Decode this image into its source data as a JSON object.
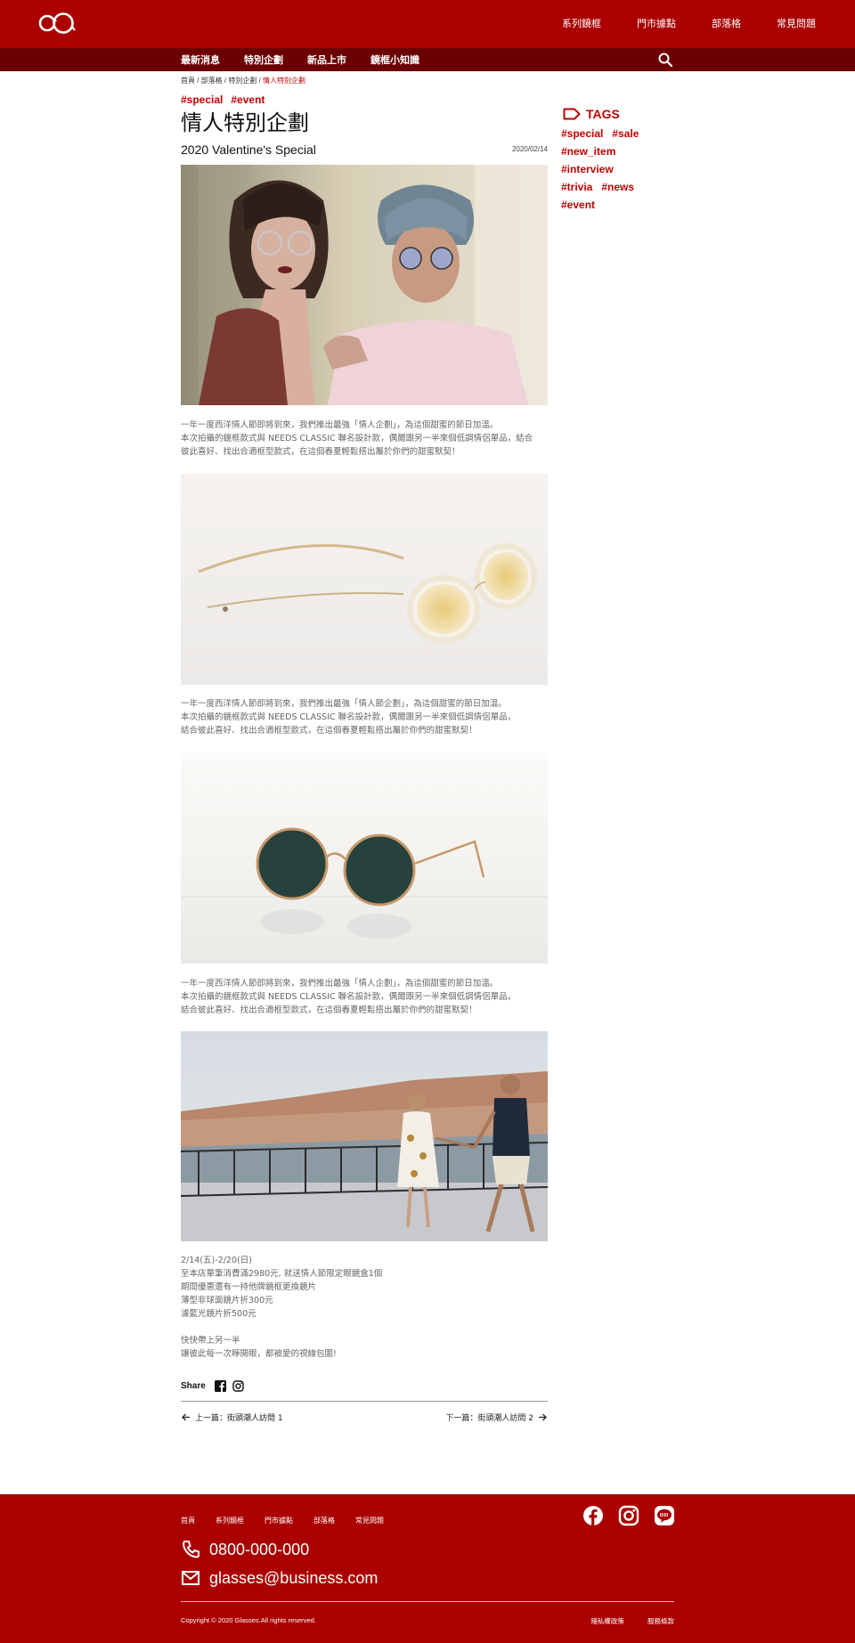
{
  "header": {
    "nav": [
      "系列鏡框",
      "門市據點",
      "部落格",
      "常見問題"
    ],
    "subnav": [
      "最新消息",
      "特別企劃",
      "新品上市",
      "鏡框小知識"
    ]
  },
  "breadcrumb": {
    "items": [
      "首頁",
      "部落格",
      "特別企劃"
    ],
    "separator": " / ",
    "current": "情人特別企劃"
  },
  "post": {
    "tags": [
      "#special",
      "#event"
    ],
    "title": "情人特別企劃",
    "subtitle": "2020 Valentine's Special",
    "date": "2020/02/14",
    "para1": [
      "一年一度西洋情人節即將到來，我們推出最強「情人企劃」，為這個甜蜜的節日加溫。",
      "本次拍攝的鏡框款式與 NEEDS CLASSIC 聯名設計款，偶爾跟另一半來個低調情侶單品，結合",
      "彼此喜好、找出合適框型款式，在這個春夏輕鬆搭出屬於你們的甜蜜默契！"
    ],
    "para2": [
      "一年一度西洋情人節即將到來，我們推出最強「情人節企劃」，為這個甜蜜的節日加溫。",
      "本次拍攝的鏡框款式與 NEEDS CLASSIC 聯名設計款，偶爾跟另一半來個低調情侶單品，",
      "結合彼此喜好、找出合適框型款式，在這個春夏輕鬆搭出屬於你們的甜蜜默契！"
    ],
    "para3": [
      "一年一度西洋情人節即將到來，我們推出最強「情人企劃」，為這個甜蜜的節日加溫。",
      "本次拍攝的鏡框款式與 NEEDS CLASSIC 聯名設計款，偶爾跟另一半來個低調情侶單品，",
      "結合彼此喜好、找出合適框型款式，在這個春夏輕鬆搭出屬於你們的甜蜜默契！"
    ],
    "promo": [
      "2/14(五)-2/20(日)",
      "至本店單筆消費滿2980元, 就送情人節限定眼鏡盒1個",
      "期間優惠還有一持他牌鏡框更換鏡片",
      "薄型非球面鏡片折300元",
      "濾藍光鏡片折500元"
    ],
    "closing": [
      "快快帶上另一半",
      "讓彼此每一次睜開眼，都被愛的視線包圍!"
    ],
    "share_label": "Share",
    "prev": "上一篇：街頭潮人訪問 1",
    "next": "下一篇：街頭潮人訪問 2"
  },
  "sidebar": {
    "heading": "TAGS",
    "tags": [
      "#special",
      "#sale",
      "#new_item",
      "#interview",
      "#trivia",
      "#news",
      "#event"
    ]
  },
  "footer": {
    "nav": [
      "首頁",
      "系列鏡框",
      "門市據點",
      "部落格",
      "常見問題"
    ],
    "phone": "0800-000-000",
    "email": "glasses@business.com",
    "copyright": "Copyright © 2020 Glasses.All rights reserved.",
    "links": [
      "隱私權政策",
      "服務條款"
    ]
  },
  "colors": {
    "brand": "#aa0000",
    "brand_dark": "#6b0000",
    "accent_text": "#c00000"
  },
  "icons": [
    "glasses-logo-icon",
    "search-icon",
    "tag-icon",
    "facebook-icon",
    "instagram-icon",
    "line-icon",
    "phone-icon",
    "mail-icon",
    "arrow-left-icon",
    "arrow-right-icon"
  ]
}
